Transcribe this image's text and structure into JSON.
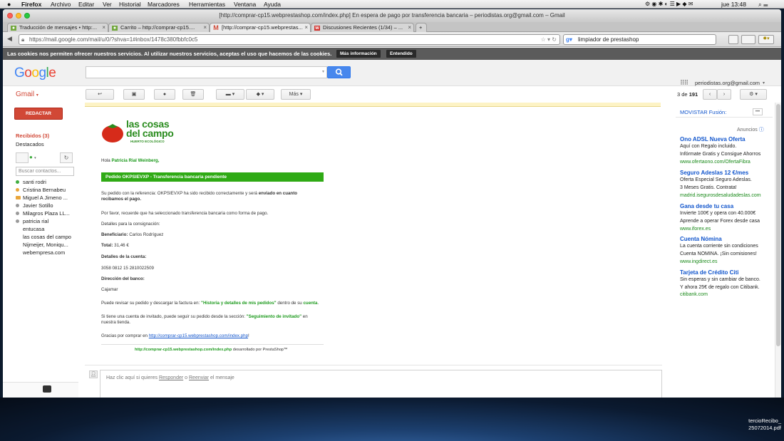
{
  "macos_menubar": {
    "apple": "",
    "items": [
      "Firefox",
      "Archivo",
      "Editar",
      "Ver",
      "Historial",
      "Marcadores",
      "Herramientas",
      "Ventana",
      "Ayuda"
    ],
    "clock": "jue 13:48"
  },
  "window": {
    "title": "[http://comprar-cp15.webprestashop.com/index.php] En espera de pago por transferencia bancaria – periodistas.org@gmail.com – Gmail"
  },
  "tabs": [
    {
      "label": "Traducción de mensajes • http:..."
    },
    {
      "label": "Carrito – http://comprar-cp15...."
    },
    {
      "label": "[http://comprar-cp15.webprestas..."
    },
    {
      "label": "Discusiones Recientes (1/34) – ..."
    }
  ],
  "navbar": {
    "url": "https://mail.google.com/mail/u/0/?shva=1#inbox/1478c380fbbfc0c5",
    "search_value": "limpiador de prestashop"
  },
  "cookie_bar": {
    "text": "Las cookies nos permiten ofrecer nuestros servicios. Al utilizar nuestros servicios, aceptas el uso que hacemos de las cookies.",
    "more_info": "Más información",
    "ok": "Entendido"
  },
  "gmail": {
    "logo": "Google",
    "account": "periodistas.org@gmail.com",
    "app_label": "Gmail",
    "more_label": "Más",
    "pager_prefix": "3 de",
    "pager_total": "191",
    "compose": "REDACTAR",
    "nav": [
      "Recibidos (3)",
      "Destacados"
    ],
    "contacts_placeholder": "Buscar contactos...",
    "contacts": [
      "santi rodri",
      "Cristina Bernabeu",
      "Miguel A Jimeno ...",
      "Javier Sotillo",
      "Milagros Plaza LL...",
      "patricia rial",
      "entucasa",
      "las cosas del campo",
      "Nijmeijer, Moniqu...",
      "webempresa.com"
    ]
  },
  "message": {
    "logo_line1": "las cosas",
    "logo_line2": "del campo",
    "logo_sub": "HUERTO ECOLÓGICO",
    "greeting": "Hola",
    "greeting_name": "Patricia Rial Weinberg,",
    "banner": "Pedido OKPSIEVXP - Transferencia bancaria pendiente",
    "p1a": "Su pedido con la referencia: OKPSIEVXP ha sido recibido correctamente y será",
    "p1b": "enviado en cuanto",
    "p1c": "recibamos el pago.",
    "p2": "Por favor, recuerde que ha seleccionado transferencia bancaria como forma de pago.",
    "p3": "Detalles para la consignación:",
    "beneficiary_label": "Beneficiario:",
    "beneficiary": "Carlos Rodríguez",
    "total_label": "Total:",
    "total": "31,46 €",
    "account_label": "Detalles de la cuenta:",
    "account_number": "3058 0812 15 2810022509",
    "bank_label": "Dirección del banco:",
    "bank": "Cajamar",
    "p4a": "Puede revisar su pedido y descargar la factura en:",
    "p4b": "\"Historia y detalles de mis pedidos\"",
    "p4c": "dentro de su",
    "p4d": "cuenta",
    "p5a": "Si tiene una cuenta de invitado, puede seguir su pedido desde la sección:",
    "p5b": "\"Seguimiento de invitado\"",
    "p5c": "en",
    "p5d": "nuestra tienda.",
    "p6a": "Gracias por comprar en",
    "p6b": "http://comprar-cp15.webprestashop.com/index.php",
    "p6c": "!",
    "footer_link": "http://comprar-cp15.webprestashop.com/index.php",
    "footer_text": "desarrollado por PrestaShop™",
    "reply_a": "Haz clic aquí si quieres",
    "reply_b": "Responder",
    "reply_c": "o",
    "reply_d": "Reenviar",
    "reply_e": "el mensaje"
  },
  "ads": {
    "movistar": "MOVISTAR Fusión:",
    "anuncios": "Anuncios",
    "items": [
      {
        "title": "Ono ADSL Nueva Oferta",
        "l1": "Aquí con Regalo incluido.",
        "l2": "Infórmate Gratis y Consigue Ahorros",
        "url": "www.ofertaono.com/OfertaFibra"
      },
      {
        "title": "Seguro Adeslas 12 €/mes",
        "l1": "Oferta Especial Seguro Adeslas.",
        "l2": "3 Meses Gratis. Contrata!",
        "url": "madrid.isegurosdesaludadeslas.com"
      },
      {
        "title": "Gana desde tu casa",
        "l1": "Invierte 100€ y opera con 40.000€",
        "l2": "Aprende a operar Forex desde casa",
        "url": "www.iforex.es"
      },
      {
        "title": "Cuenta Nómina",
        "l1": "La cuenta corriente sin condiciones",
        "l2": "Cuenta NOMINA. ¡Sin comisiones!",
        "url": "www.ingdirect.es"
      },
      {
        "title": "Tarjeta de Crédito Citi",
        "l1": "Sin esperas y sin cambiar de banco.",
        "l2": "Y ahora 25€ de regalo con Citibank.",
        "url": "citibank.com"
      }
    ]
  },
  "desktop": {
    "file_label_1": "tercioRecibo_",
    "file_label_2": "25072014.pdf"
  }
}
